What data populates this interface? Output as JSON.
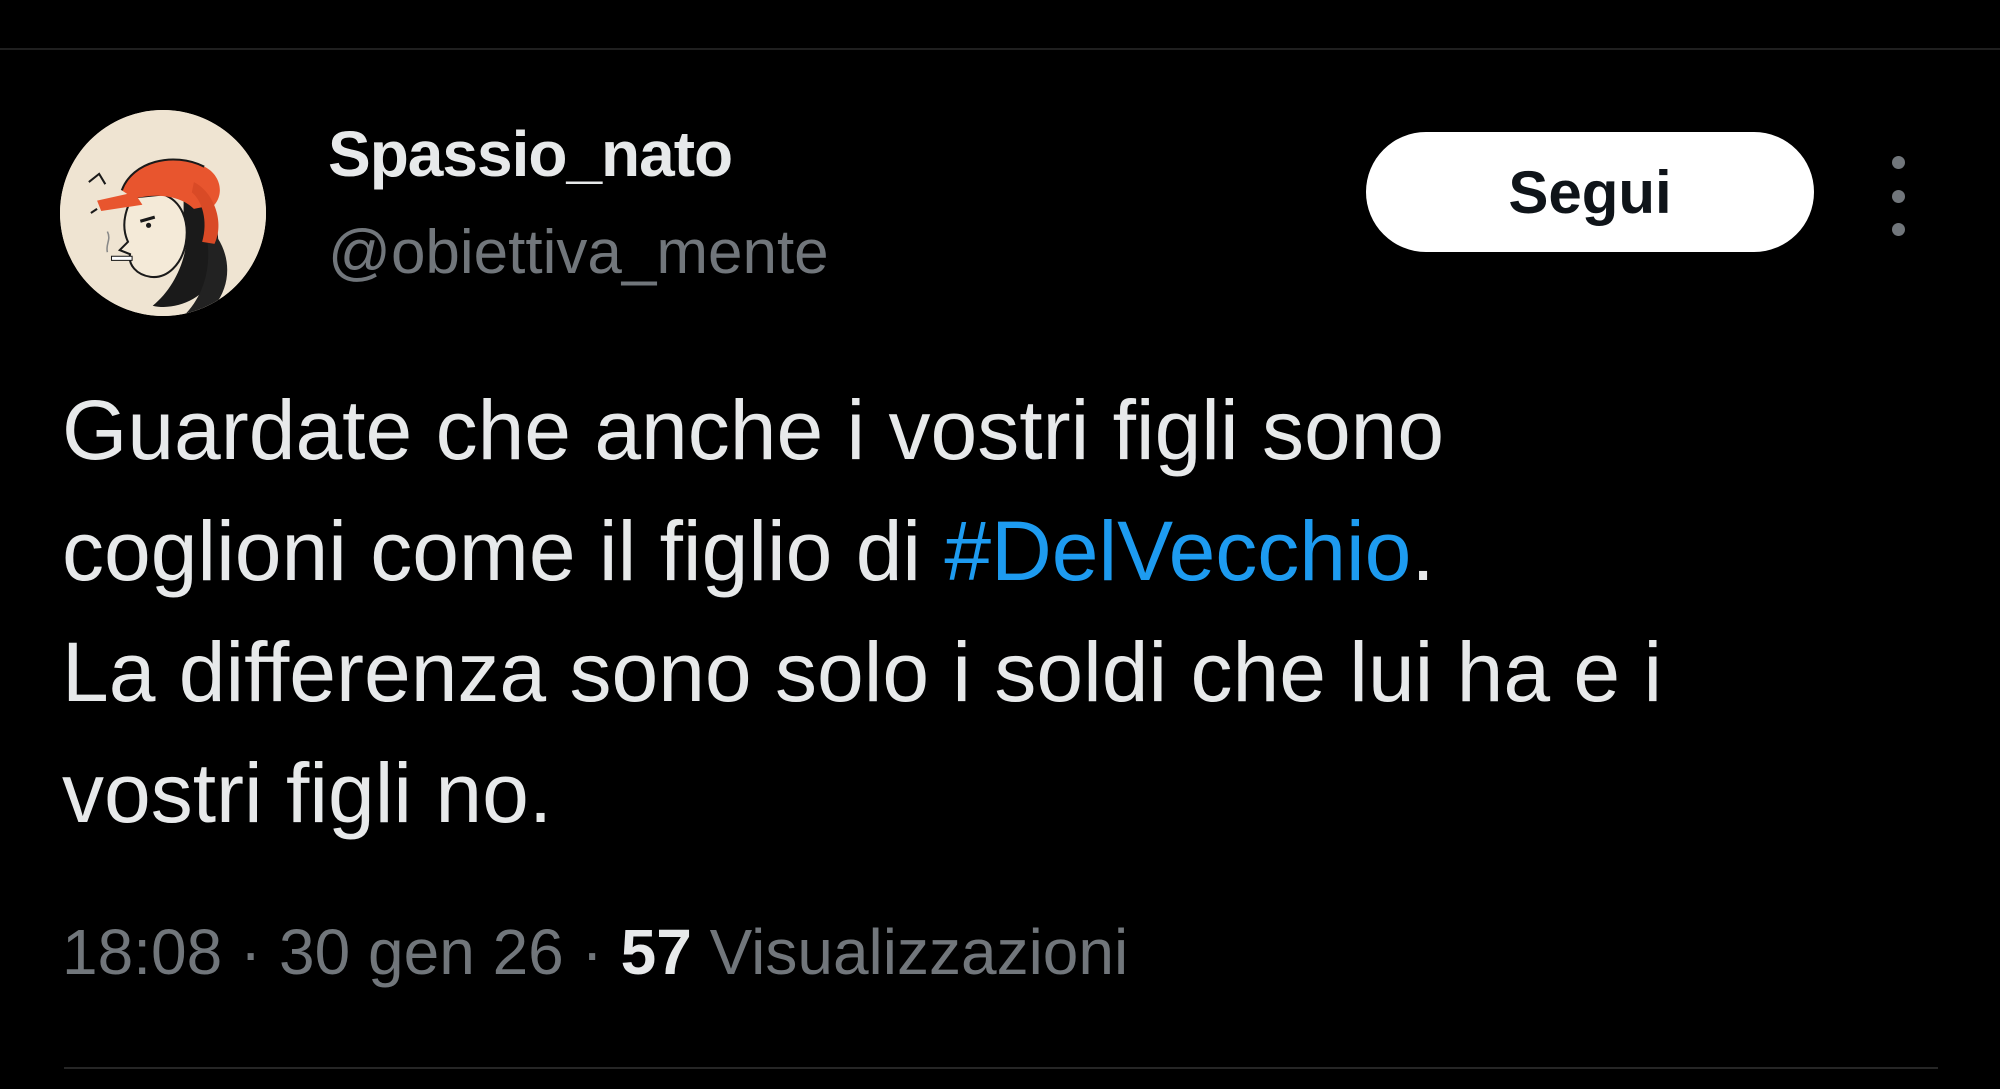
{
  "user": {
    "display_name": "Spassio_nato",
    "handle": "@obiettiva_mente"
  },
  "follow_button": {
    "label": "Segui"
  },
  "more_button": {
    "icon": "more-vertical-icon"
  },
  "tweet": {
    "line1": "Guardate che anche i vostri figli sono",
    "line2_before": "coglioni come il figlio di ",
    "hashtag": "#DelVecchio",
    "line2_after": ".",
    "line3": "La differenza sono solo i soldi che lui ha e i",
    "line4": "vostri figli no."
  },
  "meta": {
    "time": "18:08",
    "sep1": " · ",
    "date": "30 gen 26",
    "sep2": " · ",
    "views_count": "57",
    "views_label": " Visualizzazioni"
  },
  "colors": {
    "background": "#000000",
    "text": "#e7e9ea",
    "secondary": "#71767b",
    "link": "#1d9bf0",
    "button_bg": "#ffffff",
    "avatar_hat": "#e8552e"
  }
}
